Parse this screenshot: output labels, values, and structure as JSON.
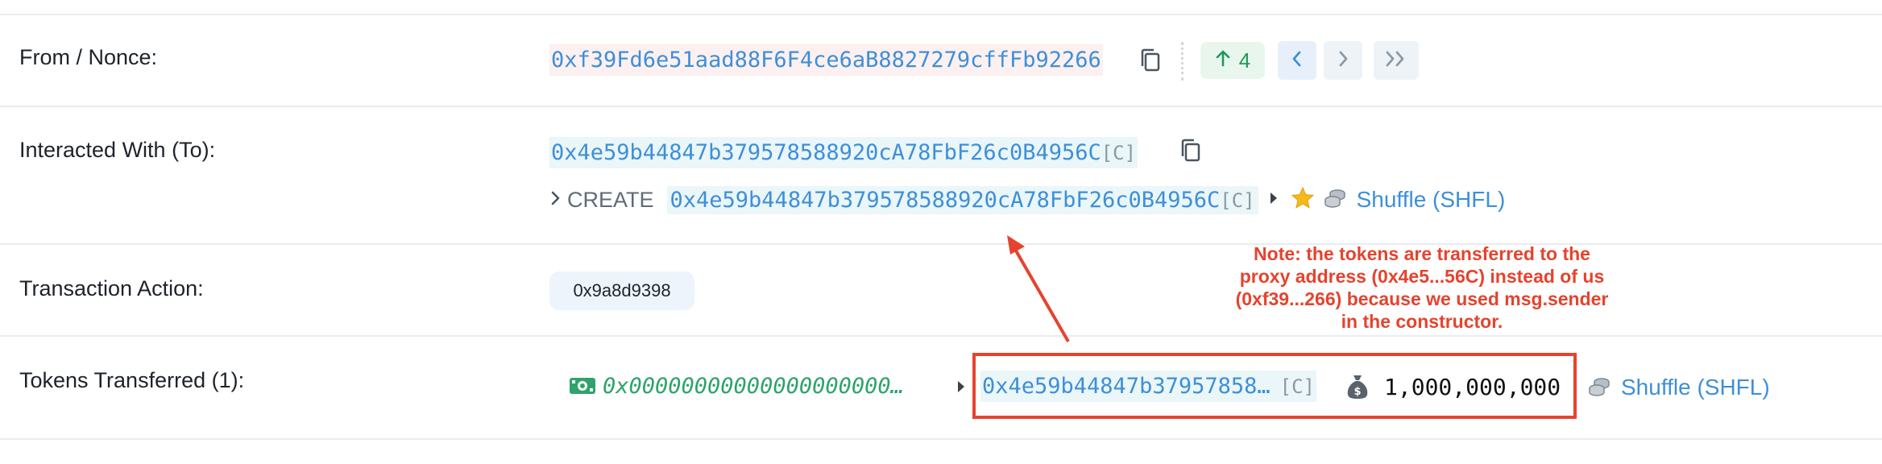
{
  "rows": {
    "from": {
      "label": "From / Nonce:",
      "address": "0xf39Fd6e51aad88F6F4ce6aB8827279cffFb92266",
      "nonce": "4"
    },
    "to": {
      "label": "Interacted With (To):",
      "address": "0x4e59b44847b379578588920cA78FbF26c0B4956C",
      "contract_tag": "[C]",
      "create_label": "CREATE",
      "create_address": "0x4e59b44847b379578588920cA78FbF26c0B4956C",
      "create_tag": "[C]",
      "token_name": "Shuffle (SHFL)"
    },
    "action": {
      "label": "Transaction Action:",
      "value": "0x9a8d9398"
    },
    "tokens": {
      "label": "Tokens Transferred (1):",
      "from_address": "0x00000000000000000000…",
      "to_address": "0x4e59b44847b37957858…",
      "to_tag": "[C]",
      "amount": "1,000,000,000",
      "token_name": "Shuffle (SHFL)"
    }
  },
  "annotation": {
    "lines": [
      "Note: the tokens are transferred to the",
      "proxy address (0x4e5...56C) instead of us",
      "(0xf39...266) because we used msg.sender",
      "in the constructor."
    ]
  },
  "colors": {
    "link": "#3e8fd9",
    "annotation_red": "#e5432e",
    "nonce_green": "#1d9a57",
    "from_green": "#2ea36b"
  },
  "icons": [
    "copy-icon",
    "arrow-up-icon",
    "chevron-left-icon",
    "chevron-right-icon",
    "double-chevron-right-icon",
    "chevron-right-small-icon",
    "triangle-right-icon",
    "star-icon",
    "coins-icon",
    "cash-icon",
    "money-bag-icon"
  ]
}
